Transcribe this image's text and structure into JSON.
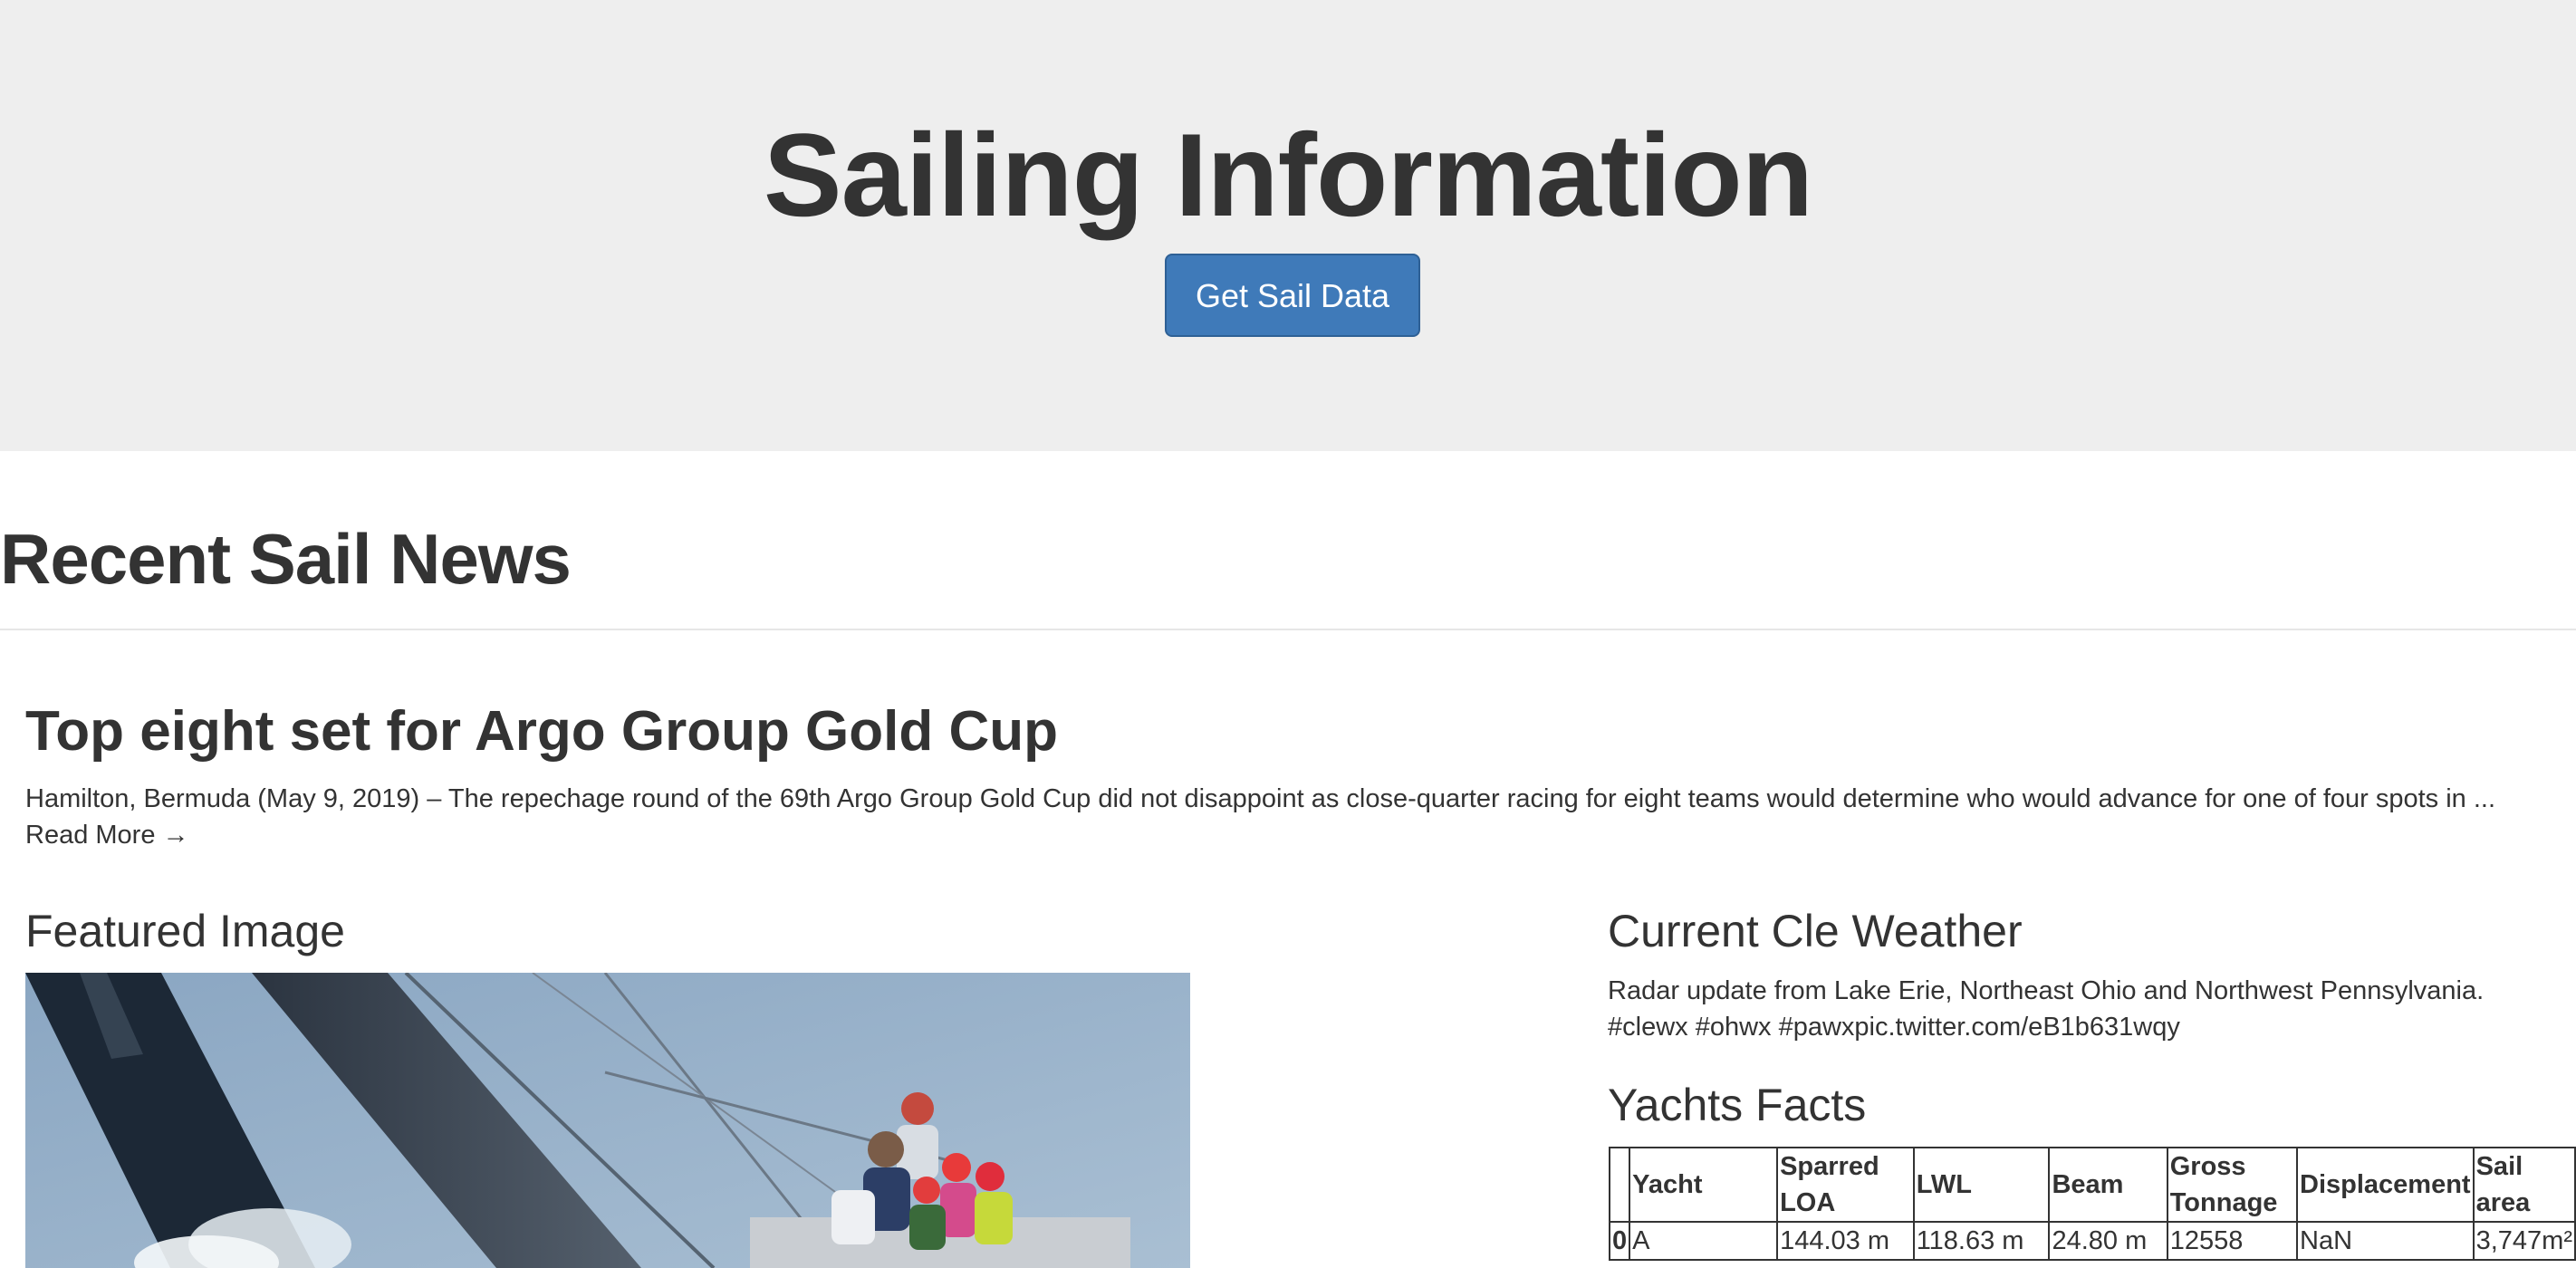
{
  "hero": {
    "title": "Sailing Information",
    "button_label": "Get Sail Data"
  },
  "news_section": {
    "title": "Recent Sail News",
    "article": {
      "title": "Top eight set for Argo Group Gold Cup",
      "body": "Hamilton, Bermuda (May 9, 2019) – The repechage round of the 69th Argo Group Gold Cup did not disappoint as close-quarter racing for eight teams would determine who would advance for one of four spots in ... ",
      "read_more": "Read More →"
    }
  },
  "featured": {
    "title": "Featured Image"
  },
  "weather": {
    "title": "Current Cle Weather",
    "text": "Radar update from Lake Erie, Northeast Ohio and Northwest Pennsylvania. #clewx #ohwx #pawxpic.twitter.com/eB1b631wqy"
  },
  "yachts": {
    "title": "Yachts Facts",
    "columns": [
      "",
      "Yacht",
      "Sparred LOA",
      "LWL",
      "Beam",
      "Gross Tonnage",
      "Displacement",
      "Sail area"
    ],
    "rows": [
      {
        "index": "0",
        "yacht": "A",
        "sparred_loa": "144.03 m",
        "lwl": "118.63 m",
        "beam": "24.80 m",
        "gross_tonnage": "12558",
        "displacement": "NaN",
        "sail_area": "3,747m²"
      }
    ]
  },
  "colors": {
    "jumbotron_bg": "#eeeeee",
    "button_bg": "#3f7ab9",
    "text": "#333333"
  }
}
